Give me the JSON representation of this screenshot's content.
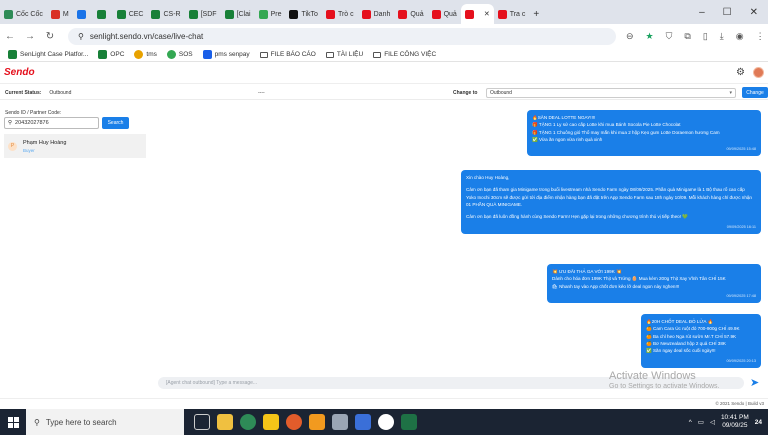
{
  "browser": {
    "tabs": [
      {
        "label": "Cốc Cốc",
        "color": "#2e8b57"
      },
      {
        "label": "M",
        "color": "#d93025"
      },
      {
        "label": "",
        "color": "#1a73e8"
      },
      {
        "label": "",
        "color": "#188038"
      },
      {
        "label": "CEC",
        "color": "#188038"
      },
      {
        "label": "CS-R",
        "color": "#188038"
      },
      {
        "label": "[SDF",
        "color": "#188038"
      },
      {
        "label": "[Clai",
        "color": "#188038"
      },
      {
        "label": "Pre",
        "color": "#34a853"
      },
      {
        "label": "TikTo",
        "color": "#111111"
      },
      {
        "label": "Trò c",
        "color": "#e5101d"
      },
      {
        "label": "Danh",
        "color": "#e5101d"
      },
      {
        "label": "Quả",
        "color": "#e5101d"
      },
      {
        "label": "Quả",
        "color": "#e5101d"
      },
      {
        "label": "",
        "color": "#e5101d"
      },
      {
        "label": "Tra c",
        "color": "#e5101d"
      }
    ],
    "url": "senlight.sendo.vn/case/live-chat",
    "bookmarks": [
      "SenLight Case Platfor...",
      "OPC",
      "tms",
      "SOS",
      "pms senpay",
      "FILE BÁO CÁO",
      "TÀI LIỆU",
      "FILE CÔNG VIỆC"
    ]
  },
  "app": {
    "logo": "Sendo",
    "status_label": "Current Status:",
    "status_value": "Outbound",
    "status_dash": "----",
    "change_to_label": "Change to",
    "change_to_value": "Outbound",
    "change_button": "Change"
  },
  "left": {
    "id_label": "Sendo ID / Partner Code:",
    "search_value": "20432027876",
    "search_button": "Search",
    "contact": {
      "initial": "P",
      "name": "Phạm Huy Hoàng",
      "role": "Buyer"
    }
  },
  "messages": [
    {
      "lines": [
        "🔥SĂN DEAL LOTTE NGAY!!!!",
        "🎁 TẶNG 1 Ly sứ cao cấp Lotte khi mua Bánh Socola Pie Lotte Chocolat",
        "🎁 TẶNG 1 Chuông gió Thổ may mắn khi mua 2 hộp Kẹo gum Lotte Doraemon hương Cam",
        "✅ Vừa ăn ngon vừa rinh quà xinh"
      ],
      "time": "09/09/2025 15:48"
    },
    {
      "lines": [
        "Xin chào Huy Hoàng,",
        "",
        "Cảm ơn bạn đã tham gia Minigame trong buổi livestream nhà Sendo Farm ngày 08/09/2025. Phần quà Minigame là 1 Bộ thau rổ cao cấp Yoko Inochi 30cm sẽ được gửi tới địa điểm nhận hàng bạn đã đặt trên App Sendo Farm sau 18h ngày 10/09. Mỗi khách hàng chỉ được nhận 01 PHẦN QUÀ MINIGAME.",
        "",
        "Cảm ơn bạn đã luôn đồng hành cùng Sendo Farm! Hẹn gặp lại trong những chương trình thú vị tiếp theo! 💚"
      ],
      "time": "09/09/2025 16:11"
    },
    {
      "lines": [
        "💥 ƯU ĐÃI THẢ GA VỚI 199K 💥",
        "Dành cho hóa đơn 199K Thịt và Trứng 🥚 Mua kèm 200g Thịt Xay Vĩnh Tân CHỈ 15K",
        "🛍 Nhanh tay vào App chốt đơn kẻo lỡ deal ngon này nghen!!!"
      ],
      "time": "09/09/2025 17:48"
    },
    {
      "lines": [
        "🔥20H CHỐT DEAL ĐỎ LỬA 🔥",
        "🍊 Cam Cara Úc ruột đỏ 700-900g CHỈ 49.9K",
        "🍊 Ba chỉ heo Nga rút sườn Mr.T CHỈ 57.9K",
        "🍊 Bơ Newzealand hộp 2 quả CHỈ 38K",
        "✅ Săn ngay deal sốc cuối ngày!!!"
      ],
      "time": "09/09/2025 20:13"
    }
  ],
  "composer_placeholder": "[Agent chat outbound] Type a message...",
  "watermark": {
    "line1": "Activate Windows",
    "line2": "Go to Settings to activate Windows."
  },
  "footer": "© 2021 Sendo | Build v3",
  "taskbar": {
    "search_placeholder": "Type here to search",
    "time": "10:41 PM",
    "date": "09/09/25",
    "temp": "24"
  }
}
